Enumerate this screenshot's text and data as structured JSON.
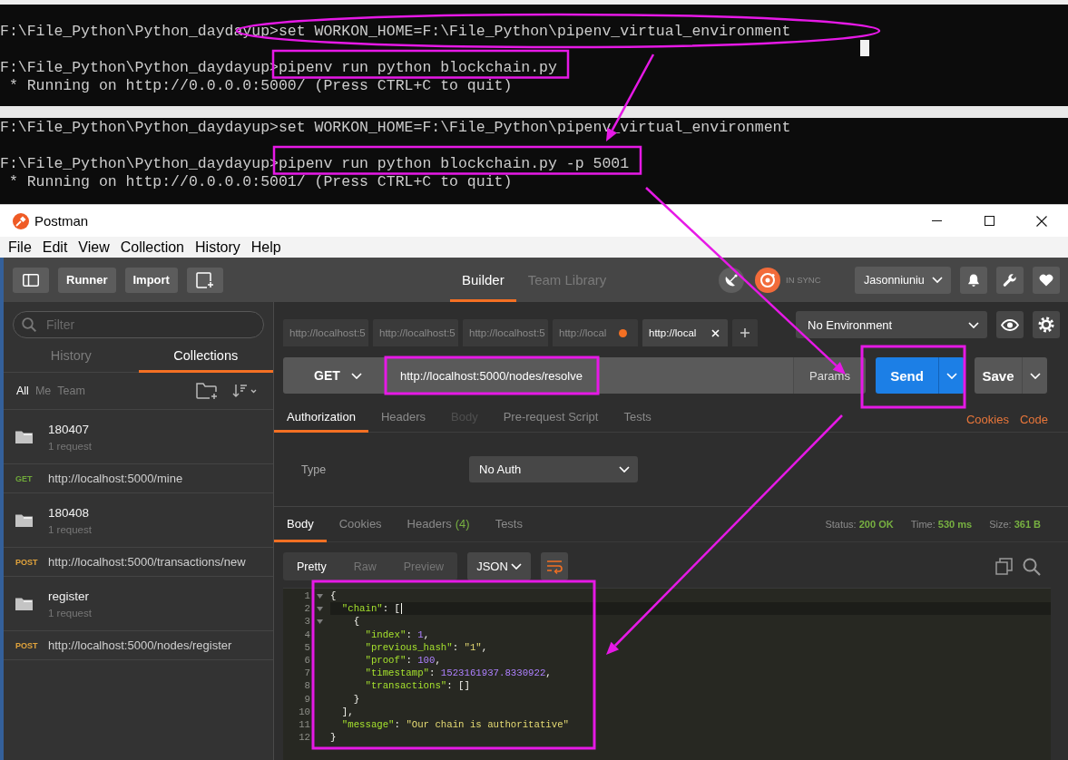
{
  "terminals": [
    {
      "cursor": true,
      "lines": [
        {
          "kind": "command",
          "prompt": "F:\\File_Python\\Python_daydayup>",
          "text": "set WORKON_HOME=F:\\File_Python\\pipenv_virtual_environment"
        },
        {
          "kind": "command",
          "prompt": "F:\\File_Python\\Python_daydayup>",
          "text": "pipenv run python blockchain.py"
        },
        {
          "kind": "output",
          "text": "* Running on http://0.0.0.0:5000/ (Press CTRL+C to quit)"
        }
      ]
    },
    {
      "cursor": false,
      "lines": [
        {
          "kind": "command",
          "prompt": "F:\\File_Python\\Python_daydayup>",
          "text": "set WORKON_HOME=F:\\File_Python\\pipenv_virtual_environment"
        },
        {
          "kind": "command",
          "prompt": "F:\\File_Python\\Python_daydayup>",
          "text": "pipenv run python blockchain.py -p 5001"
        },
        {
          "kind": "output",
          "text": "* Running on http://0.0.0.0:5001/ (Press CTRL+C to quit)"
        }
      ]
    }
  ],
  "window": {
    "title": "Postman"
  },
  "menu": [
    "File",
    "Edit",
    "View",
    "Collection",
    "History",
    "Help"
  ],
  "toolbar": {
    "buttons": [
      "Runner",
      "Import"
    ],
    "tabs": [
      {
        "label": "Builder",
        "selected": true
      },
      {
        "label": "Team Library",
        "selected": false
      }
    ],
    "sync": "IN SYNC",
    "user": "Jasonniuniu"
  },
  "sidebar": {
    "filter": {
      "placeholder": "Filter"
    },
    "tabs": [
      {
        "label": "History",
        "selected": false
      },
      {
        "label": "Collections",
        "selected": true
      }
    ],
    "scopes": [
      {
        "label": "All",
        "selected": true
      },
      {
        "label": "Me",
        "selected": false
      },
      {
        "label": "Team",
        "selected": false
      }
    ],
    "items": [
      {
        "kind": "folder",
        "name": "180407",
        "count": "1 request"
      },
      {
        "kind": "request",
        "method": "GET",
        "color": "#6fa83a",
        "url": "http://localhost:5000/mine"
      },
      {
        "kind": "folder",
        "name": "180408",
        "count": "1 request"
      },
      {
        "kind": "request",
        "method": "POST",
        "color": "#e2a43c",
        "url": "http://localhost:5000/transactions/new"
      },
      {
        "kind": "folder",
        "name": "register",
        "count": "1 request"
      },
      {
        "kind": "request",
        "method": "POST",
        "color": "#e2a43c",
        "url": "http://localhost:5000/nodes/register"
      }
    ]
  },
  "request_tabs": [
    {
      "label": "http://localhost:5",
      "selected": false,
      "unsaved": false
    },
    {
      "label": "http://localhost:5",
      "selected": false,
      "unsaved": false
    },
    {
      "label": "http://localhost:5",
      "selected": false,
      "unsaved": false
    },
    {
      "label": "http://local",
      "selected": false,
      "unsaved": true
    },
    {
      "label": "http://local",
      "selected": true,
      "unsaved": false
    }
  ],
  "environment": "No Environment",
  "request": {
    "method": "GET",
    "url": "http://localhost:5000/nodes/resolve",
    "params": "Params",
    "send": "Send",
    "save": "Save",
    "sections": [
      {
        "label": "Authorization",
        "selected": true,
        "disabled": false
      },
      {
        "label": "Headers",
        "selected": false,
        "disabled": false
      },
      {
        "label": "Body",
        "selected": false,
        "disabled": true
      },
      {
        "label": "Pre-request Script",
        "selected": false,
        "disabled": false
      },
      {
        "label": "Tests",
        "selected": false,
        "disabled": false
      }
    ],
    "links": [
      "Cookies",
      "Code"
    ],
    "auth": {
      "label": "Type",
      "value": "No Auth"
    }
  },
  "response": {
    "tabs": [
      {
        "label": "Body",
        "selected": true
      },
      {
        "label": "Cookies",
        "selected": false
      },
      {
        "label": "Headers",
        "badge": "(4)",
        "selected": false
      },
      {
        "label": "Tests",
        "selected": false
      }
    ],
    "status": [
      {
        "label": "Status:",
        "value": "200 OK"
      },
      {
        "label": "Time:",
        "value": "530 ms"
      },
      {
        "label": "Size:",
        "value": "361 B"
      }
    ],
    "views": [
      {
        "label": "Pretty",
        "selected": true
      },
      {
        "label": "Raw",
        "selected": false
      },
      {
        "label": "Preview",
        "selected": false
      }
    ],
    "format": "JSON",
    "lines": [
      {
        "number": "1",
        "active": false,
        "tokens": [
          {
            "kind": "punct",
            "text": "{"
          }
        ],
        "children": [
          {
            "number": "2",
            "active": true,
            "tokens": [
              {
                "kind": "key",
                "text": "\"chain\""
              },
              {
                "kind": "punct",
                "text": ": ["
              }
            ],
            "children": [
              {
                "number": "3",
                "active": false,
                "tokens": [
                  {
                    "kind": "punct",
                    "text": "{"
                  }
                ],
                "children": [
                  {
                    "number": "4",
                    "active": false,
                    "tokens": [
                      {
                        "kind": "key",
                        "text": "\"index\""
                      },
                      {
                        "kind": "punct",
                        "text": ": "
                      },
                      {
                        "kind": "number",
                        "text": "1"
                      },
                      {
                        "kind": "punct",
                        "text": ","
                      }
                    ]
                  },
                  {
                    "number": "5",
                    "active": false,
                    "tokens": [
                      {
                        "kind": "key",
                        "text": "\"previous_hash\""
                      },
                      {
                        "kind": "punct",
                        "text": ": "
                      },
                      {
                        "kind": "string",
                        "text": "\"1\""
                      },
                      {
                        "kind": "punct",
                        "text": ","
                      }
                    ]
                  },
                  {
                    "number": "6",
                    "active": false,
                    "tokens": [
                      {
                        "kind": "key",
                        "text": "\"proof\""
                      },
                      {
                        "kind": "punct",
                        "text": ": "
                      },
                      {
                        "kind": "number",
                        "text": "100"
                      },
                      {
                        "kind": "punct",
                        "text": ","
                      }
                    ]
                  },
                  {
                    "number": "7",
                    "active": false,
                    "tokens": [
                      {
                        "kind": "key",
                        "text": "\"timestamp\""
                      },
                      {
                        "kind": "punct",
                        "text": ": "
                      },
                      {
                        "kind": "number",
                        "text": "1523161937.8330922"
                      },
                      {
                        "kind": "punct",
                        "text": ","
                      }
                    ]
                  },
                  {
                    "number": "8",
                    "active": false,
                    "tokens": [
                      {
                        "kind": "key",
                        "text": "\"transactions\""
                      },
                      {
                        "kind": "punct",
                        "text": ": []"
                      }
                    ]
                  }
                ]
              },
              {
                "number": "9",
                "active": false,
                "tokens": [
                  {
                    "kind": "punct",
                    "text": "}"
                  }
                ]
              }
            ]
          },
          {
            "number": "10",
            "active": false,
            "tokens": [
              {
                "kind": "punct",
                "text": "],"
              }
            ]
          },
          {
            "number": "11",
            "active": false,
            "tokens": [
              {
                "kind": "key",
                "text": "\"message\""
              },
              {
                "kind": "punct",
                "text": ": "
              },
              {
                "kind": "string",
                "text": "\"Our chain is authoritative\""
              }
            ]
          }
        ]
      },
      {
        "number": "12",
        "active": false,
        "tokens": [
          {
            "kind": "punct",
            "text": "}"
          }
        ]
      }
    ]
  }
}
